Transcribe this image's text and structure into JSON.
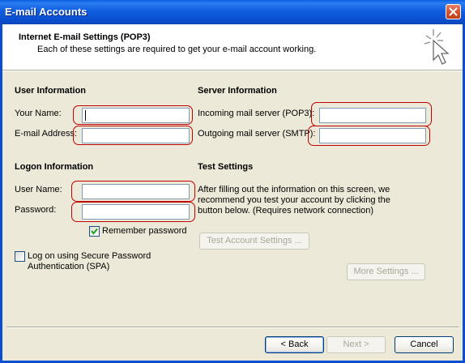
{
  "window": {
    "title": "E-mail Accounts"
  },
  "header": {
    "title": "Internet E-mail Settings (POP3)",
    "subtitle": "Each of these settings are required to get your e-mail account working."
  },
  "user_info": {
    "heading": "User Information",
    "name_label": "Your Name:",
    "name_value": "",
    "email_label": "E-mail Address:",
    "email_value": ""
  },
  "server_info": {
    "heading": "Server Information",
    "incoming_label": "Incoming mail server (POP3):",
    "incoming_value": "",
    "outgoing_label": "Outgoing mail server (SMTP):",
    "outgoing_value": ""
  },
  "logon_info": {
    "heading": "Logon Information",
    "username_label": "User Name:",
    "username_value": "",
    "password_label": "Password:",
    "password_value": "",
    "remember_label": "Remember password",
    "remember_checked": true,
    "spa_label_line1": "Log on using Secure Password",
    "spa_label_line2": "Authentication (SPA)",
    "spa_checked": false
  },
  "test_settings": {
    "heading": "Test Settings",
    "line1": "After filling out the information on this screen, we",
    "line2": "recommend you test your account by clicking the",
    "line3": "button below. (Requires network connection)",
    "test_button": "Test Account Settings ..."
  },
  "more_settings_button": "More Settings ...",
  "footer": {
    "back": "< Back",
    "next": "Next >",
    "cancel": "Cancel"
  },
  "colors": {
    "titlebar": "#0a5fe0",
    "highlight": "#c00000",
    "dialog_bg": "#ece9d8"
  },
  "icons": {
    "close": "close-icon",
    "wizard": "cursor-sparkle-icon",
    "check": "checkmark-icon"
  }
}
